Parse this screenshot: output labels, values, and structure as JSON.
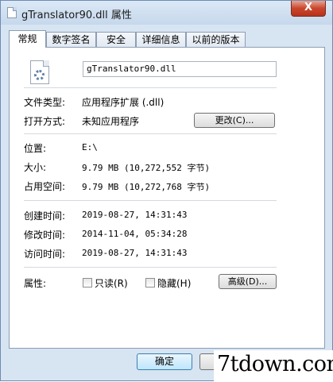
{
  "window": {
    "title": "gTranslator90.dll 属性",
    "close_label": "X"
  },
  "tabs": [
    "常规",
    "数字签名",
    "安全",
    "详细信息",
    "以前的版本"
  ],
  "file": {
    "name": "gTranslator90.dll"
  },
  "properties": {
    "file_type_label": "文件类型:",
    "file_type_value": "应用程序扩展 (.dll)",
    "open_with_label": "打开方式:",
    "open_with_value": "未知应用程序",
    "change_button": "更改(C)...",
    "location_label": "位置:",
    "location_value": "E:\\",
    "size_label": "大小:",
    "size_value": "9.79 MB (10,272,552 字节)",
    "size_on_disk_label": "占用空间:",
    "size_on_disk_value": "9.79 MB (10,272,768 字节)",
    "created_label": "创建时间:",
    "created_value": "2019-08-27, 14:31:43",
    "modified_label": "修改时间:",
    "modified_value": "2014-11-04, 05:34:28",
    "accessed_label": "访问时间:",
    "accessed_value": "2019-08-27, 14:31:43",
    "attributes_label": "属性:",
    "readonly_label": "只读(R)",
    "hidden_label": "隐藏(H)",
    "advanced_button": "高级(D)..."
  },
  "footer": {
    "ok_button": "确定"
  },
  "watermark": "7tdown.com"
}
